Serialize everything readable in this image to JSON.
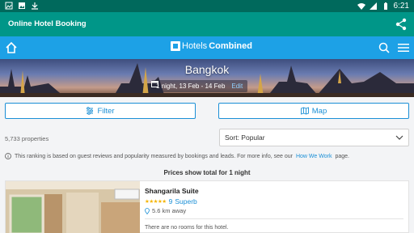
{
  "status_bar": {
    "time": "6:21"
  },
  "app_bar": {
    "title": "Online Hotel Booking",
    "share_icon": "share-icon"
  },
  "nav": {
    "logo_part1": "Hotels",
    "logo_part2": "Combined",
    "home_icon": "home-icon",
    "search_icon": "search-icon",
    "menu_icon": "menu-icon"
  },
  "hero": {
    "city": "Bangkok",
    "dates": "1 night, 13 Feb - 14 Feb",
    "edit_label": "Edit"
  },
  "actions": {
    "filter_label": "Filter",
    "map_label": "Map"
  },
  "results": {
    "count": "5,733 properties",
    "sort_value": "Sort: Popular"
  },
  "info": {
    "text": "This ranking is based on guest reviews and popularity measured by bookings and leads. For more info, see our",
    "link": "How We Work",
    "suffix": "page."
  },
  "prices_note": "Prices show total for 1 night",
  "hotel": {
    "name": "Shangarila Suite",
    "score": "9",
    "score_label": "Superb",
    "distance": "5.6 km away",
    "availability": "There are no rooms for this hotel."
  },
  "colors": {
    "status_bar": "#00695c",
    "app_bar": "#009688",
    "nav_bar": "#1da1e6",
    "accent": "#1a8fd6",
    "stars": "#f5b400"
  }
}
